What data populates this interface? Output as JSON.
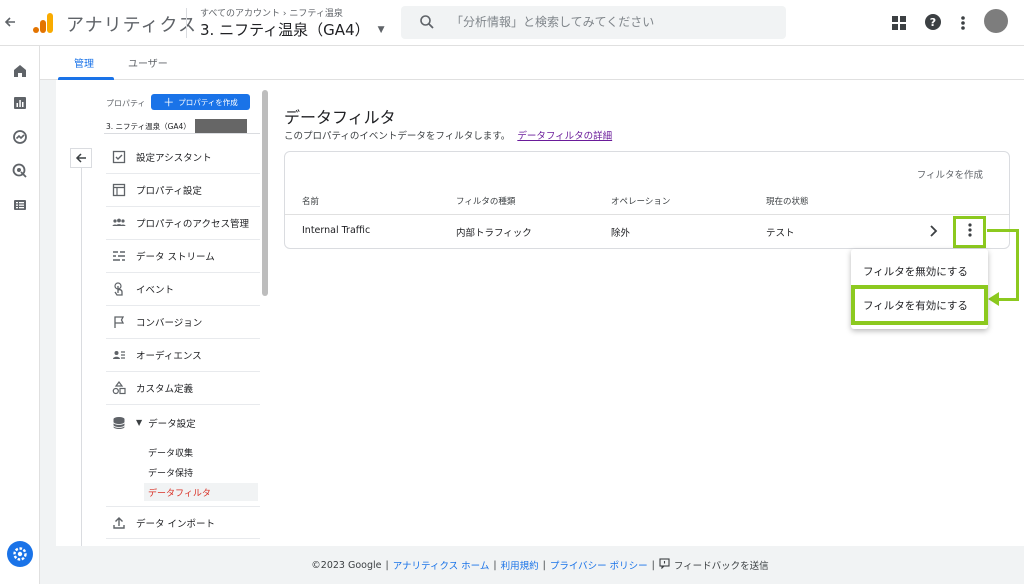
{
  "header": {
    "app_title": "アナリティクス",
    "breadcrumb_all": "すべてのアカウント",
    "breadcrumb_account": "ニフティ温泉",
    "property": "3. ニフティ温泉（GA4）",
    "search_placeholder": "「分析情報」と検索してみてください"
  },
  "tabs": {
    "admin": "管理",
    "user": "ユーザー"
  },
  "sidebar": {
    "property_label": "プロパティ",
    "create_property": "プロパティを作成",
    "property_name": "3. ニフティ温泉（GA4）",
    "items": [
      {
        "label": "設定アシスタント",
        "icon": "checklist-icon"
      },
      {
        "label": "プロパティ設定",
        "icon": "layout-icon"
      },
      {
        "label": "プロパティのアクセス管理",
        "icon": "people-icon"
      },
      {
        "label": "データ ストリーム",
        "icon": "stream-icon"
      },
      {
        "label": "イベント",
        "icon": "touch-icon"
      },
      {
        "label": "コンバージョン",
        "icon": "flag-icon"
      },
      {
        "label": "オーディエンス",
        "icon": "audience-icon"
      },
      {
        "label": "カスタム定義",
        "icon": "shapes-icon"
      }
    ],
    "data_settings": "データ設定",
    "sub_items": [
      "データ収集",
      "データ保持",
      "データフィルタ"
    ],
    "data_import": "データ インポート"
  },
  "main": {
    "title": "データフィルタ",
    "description": "このプロパティのイベントデータをフィルタします。",
    "details_link": "データフィルタの詳細",
    "create_filter": "フィルタを作成",
    "columns": [
      "名前",
      "フィルタの種類",
      "オペレーション",
      "現在の状態"
    ],
    "rows": [
      {
        "name": "Internal Traffic",
        "type": "内部トラフィック",
        "operation": "除外",
        "state": "テスト"
      }
    ]
  },
  "menu": {
    "disable": "フィルタを無効にする",
    "enable": "フィルタを有効にする"
  },
  "footer": {
    "copyright": "©2023 Google",
    "home": "アナリティクス ホーム",
    "terms": "利用規約",
    "privacy": "プライバシー ポリシー",
    "feedback": "フィードバックを送信"
  },
  "colors": {
    "accent": "#1a73e8",
    "annotation": "#8cc91f",
    "active_sub": "#d93025"
  }
}
